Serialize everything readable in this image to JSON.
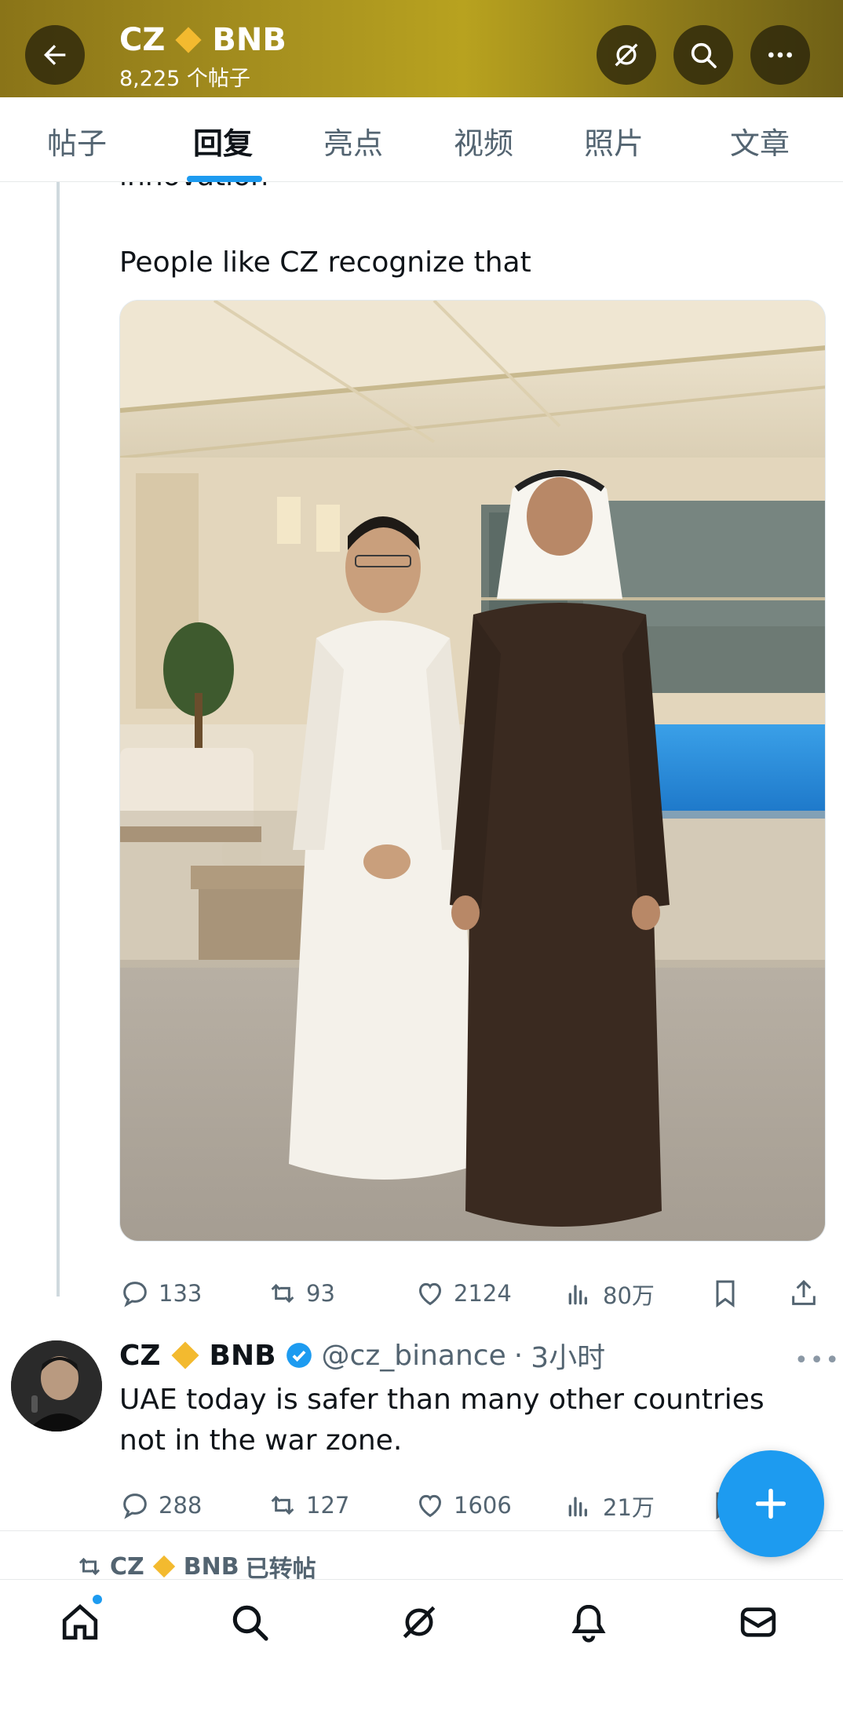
{
  "header": {
    "name_first": "CZ",
    "name_second": "BNB",
    "post_count": "8,225 个帖子",
    "icons": [
      "back-arrow-icon",
      "grok-icon",
      "search-icon",
      "more-icon"
    ]
  },
  "tabs": [
    {
      "label": "帖子"
    },
    {
      "label": "回复"
    },
    {
      "label": "亮点"
    },
    {
      "label": "视频"
    },
    {
      "label": "照片"
    },
    {
      "label": "文章"
    }
  ],
  "active_tab": "回复",
  "tweet": {
    "cut_text": "innovation",
    "text": "People like CZ recognize that",
    "stats": {
      "replies": "133",
      "reposts": "93",
      "likes": "2124",
      "views": "80万"
    }
  },
  "reply": {
    "name_first": "CZ",
    "name_second": "BNB",
    "handle": "@cz_binance",
    "separator": "·",
    "time": "3小时",
    "text": "UAE today is safer than many other countries not in the war zone.",
    "stats": {
      "replies": "288",
      "reposts": "127",
      "likes": "1606",
      "views": "21万"
    }
  },
  "next_item": {
    "text": "CZ",
    "name_second": "BNB",
    "suffix": "已转帖"
  },
  "bottom_nav": [
    "home-icon",
    "search-icon",
    "grok-icon",
    "notifications-icon",
    "messages-icon"
  ],
  "colors": {
    "accent": "#1d9bf0",
    "header_gold": "#a8921f",
    "bnb_yellow": "#f3ba2f",
    "muted": "#536471"
  }
}
